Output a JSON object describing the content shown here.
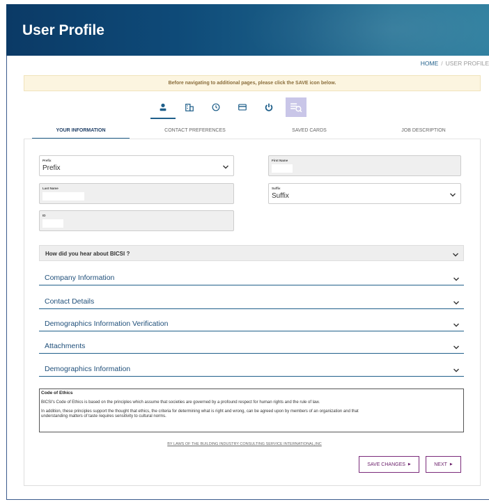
{
  "header": {
    "title": "User Profile"
  },
  "breadcrumb": {
    "home": "HOME",
    "separator": "/",
    "current": "USER PROFILE"
  },
  "notice": "Before navigating to additional pages, please click the SAVE icon below.",
  "icon_nav": [
    {
      "icon": "person-icon",
      "active": true
    },
    {
      "icon": "building-icon",
      "active": false
    },
    {
      "icon": "history-icon",
      "active": false
    },
    {
      "icon": "credit-card-icon",
      "active": false
    },
    {
      "icon": "power-icon",
      "active": false
    },
    {
      "icon": "job-description-icon",
      "active": false
    }
  ],
  "tabs": [
    {
      "label": "YOUR INFORMATION",
      "active": true
    },
    {
      "label": "CONTACT PREFERENCES",
      "active": false
    },
    {
      "label": "SAVED CARDS",
      "active": false
    },
    {
      "label": "JOB DESCRIPTION",
      "active": false
    }
  ],
  "form": {
    "prefix": {
      "label": "Prefix",
      "value": "Prefix"
    },
    "first_name": {
      "label": "First Name",
      "value": ""
    },
    "last_name": {
      "label": "Last Name",
      "value": ""
    },
    "suffix": {
      "label": "Suffix",
      "value": "Suffix"
    },
    "id": {
      "label": "ID",
      "value": ""
    }
  },
  "accordions": {
    "hear_about": "How did you hear about BICSI ?",
    "company": "Company Information",
    "contact": "Contact Details",
    "demographics_verification": "Demographics Information Verification",
    "attachments": "Attachments",
    "demographics": "Demographics Information"
  },
  "ethics": {
    "heading": "Code of Ethics",
    "para1": "BICSI's Code of Ethics is based on the principles which assume that societies are governed by a profound respect for human rights and the rule of law.",
    "para2a": "In addition, these principles support the thought that ethics, the criteria for determining what is right and wrong, can be agreed upon by members of an organization and that",
    "para2b": "understanding matters of taste requires sensitivity to cultural norms."
  },
  "bylaws_link": "BY LAWS OF THE BUILDING INDUSTRY CONSULTING SERVICE INTERNATIONAL,INC",
  "buttons": {
    "save": "SAVE CHANGES",
    "next": "NEXT"
  },
  "colors": {
    "brand": "#1f5f8a",
    "button_border": "#7a2a7a",
    "notice_bg": "#fcf5e0"
  }
}
